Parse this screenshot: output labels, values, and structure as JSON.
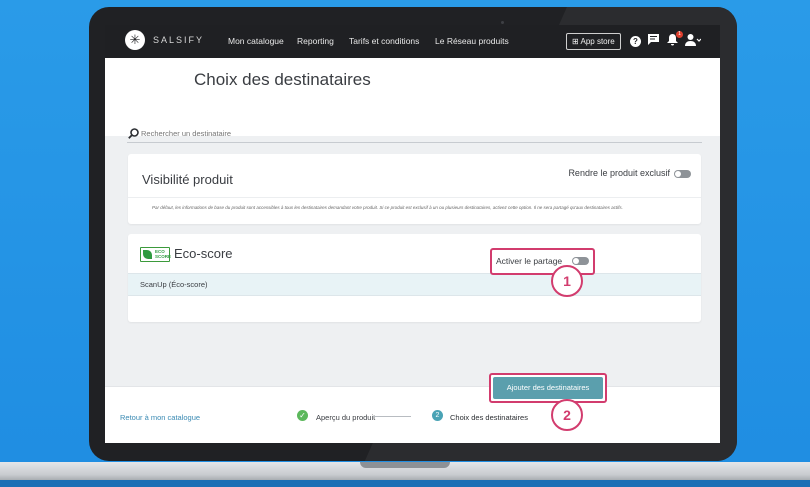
{
  "app": {
    "brand": "SALSIFY",
    "logo_icon": "salsify-logo-icon"
  },
  "nav": {
    "items": [
      "Mon catalogue",
      "Reporting",
      "Tarifs et conditions",
      "Le Réseau produits"
    ]
  },
  "topbar": {
    "app_store_label": "App store",
    "help_icon": "?",
    "messages_icon": "chat-icon",
    "notifications_icon": "bell-icon",
    "notifications_count": "1",
    "user_icon": "user-icon"
  },
  "page": {
    "title": "Choix des destinataires"
  },
  "search": {
    "placeholder": "Rechercher un destinataire"
  },
  "visibility": {
    "title": "Visibilité produit",
    "exclusive_label": "Rendre le produit exclusif",
    "exclusive_on": false,
    "description": "Par défaut, les informations de base du produit sont accessibles à tous les destinataires demandant votre produit. Si ce produit est exclusif à un ou plusieurs destinataires, activez cette option. Il ne sera partagé qu'aux destinataires actifs."
  },
  "ecoscore": {
    "logo_text": "ECO SCORE",
    "title": "Eco-score",
    "recipient": "ScanUp (Éco-score)",
    "share_label": "Activer le partage",
    "share_on": false
  },
  "annotations": {
    "step1": "1",
    "step2": "2",
    "accent_color": "#d23c6e"
  },
  "footer": {
    "back_label": "Retour à mon catalogue",
    "step1_label": "Aperçu du produit",
    "step1_done": true,
    "step2_number": "2",
    "step2_label": "Choix des destinataires",
    "primary_button": "Ajouter des destinataires",
    "primary_color": "#5b9fad"
  }
}
